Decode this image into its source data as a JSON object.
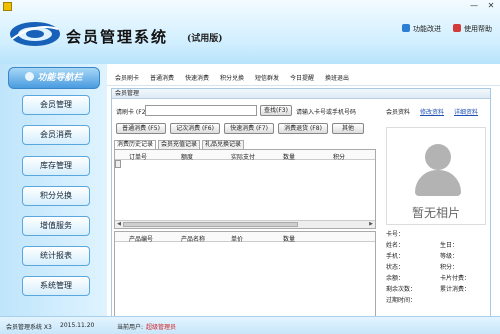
{
  "window": {
    "minimize": "—",
    "close": "✕"
  },
  "header": {
    "app_title": "会员管理系统",
    "edition": "(试用版)",
    "links": [
      {
        "label": "功能改进"
      },
      {
        "label": "使用帮助"
      }
    ]
  },
  "sidebar": {
    "head_label": "功能导航栏",
    "items": [
      {
        "label": "会员管理"
      },
      {
        "label": "会员消费"
      },
      {
        "label": "库存管理"
      },
      {
        "label": "积分兑换"
      },
      {
        "label": "增值服务"
      },
      {
        "label": "统计报表"
      },
      {
        "label": "系统管理"
      }
    ]
  },
  "menu": {
    "items": [
      {
        "label": "会员刷卡"
      },
      {
        "label": "普通消费"
      },
      {
        "label": "快速消费"
      },
      {
        "label": "积分兑换"
      },
      {
        "label": "短信群发"
      },
      {
        "label": "今日提醒"
      },
      {
        "label": "换班退出"
      }
    ]
  },
  "panel": {
    "title": "会员管理",
    "card_label": "请刷卡 (F2)：",
    "card_value": "",
    "search_button": "查找(F3)",
    "hint": "请输入卡号或手机号码",
    "actions": [
      {
        "label": "普通消费 (F5)"
      },
      {
        "label": "记次消费 (F6)"
      },
      {
        "label": "快速消费 (F7)"
      },
      {
        "label": "消费退货 (F8)"
      },
      {
        "label": "其他"
      }
    ],
    "tabs": [
      {
        "label": "消费历史记录"
      },
      {
        "label": "会员充值记录"
      },
      {
        "label": "礼品兑换记录"
      }
    ],
    "grid1_columns": [
      "订单号",
      "额度",
      "实际支付",
      "数量",
      "积分"
    ],
    "grid2_columns": [
      "产品编号",
      "产品名称",
      "单价",
      "数量"
    ]
  },
  "member_info": {
    "title": "会员资料",
    "edit_link": "修改资料",
    "detail_link": "详细资料",
    "photo_caption": "暂无相片",
    "fields_left": [
      {
        "label": "卡号："
      },
      {
        "label": "姓名："
      },
      {
        "label": "手机："
      },
      {
        "label": "状态："
      },
      {
        "label": "余额："
      },
      {
        "label": "剩余次数："
      },
      {
        "label": "过期时间："
      }
    ],
    "fields_right": [
      {
        "label": ""
      },
      {
        "label": "生日："
      },
      {
        "label": "等级："
      },
      {
        "label": "积分："
      },
      {
        "label": "卡片付费："
      },
      {
        "label": "累计消费："
      },
      {
        "label": ""
      }
    ]
  },
  "status": {
    "app_version": "会员管理系统 X3",
    "date": "2015.11.20",
    "user_prefix": "当前用户:",
    "user_name": "超级管理员"
  },
  "colors": {
    "accent": "#4a9be0",
    "user_name": "#d42020",
    "link": "#1f4fb3"
  }
}
